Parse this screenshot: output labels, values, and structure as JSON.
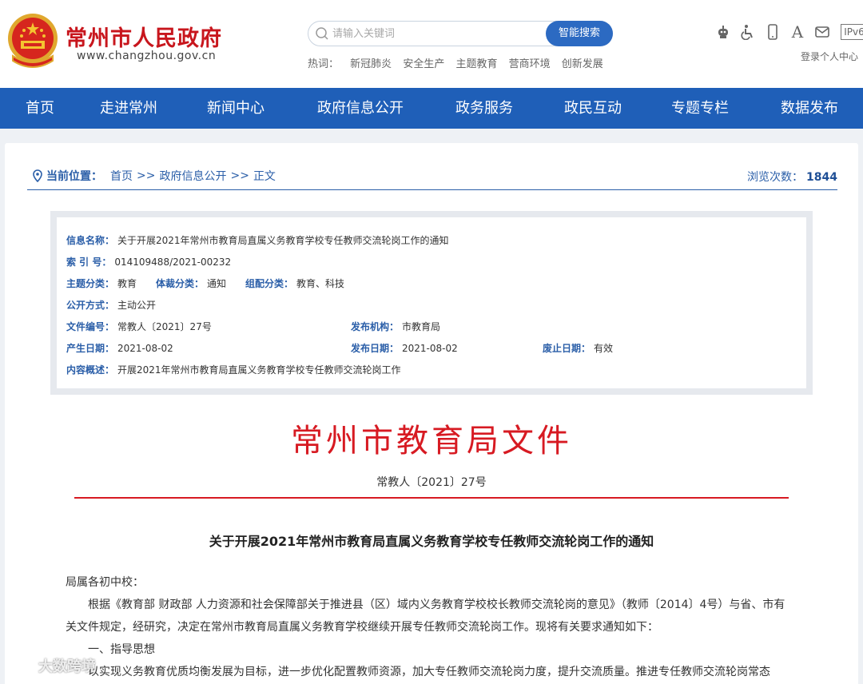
{
  "header": {
    "site_title": "常州市人民政府",
    "site_url": "www.changzhou.gov.cn",
    "emblem_icon": "national-emblem-icon",
    "search": {
      "placeholder": "请输入关键词",
      "button_label": "智能搜索",
      "hot_label": "热词：",
      "hot_words": [
        "新冠肺炎",
        "安全生产",
        "主题教育",
        "营商环境",
        "创新发展"
      ]
    },
    "tools": {
      "icons": [
        "robot-icon",
        "accessibility-icon",
        "mobile-icon",
        "font-size-icon",
        "mail-icon"
      ],
      "font_glyph": "A",
      "ipv6_label": "IPv6",
      "login_label": "登录个人中心"
    }
  },
  "nav": {
    "items": [
      "首页",
      "走进常州",
      "新闻中心",
      "政府信息公开",
      "政务服务",
      "政民互动",
      "专题专栏",
      "数据发布"
    ]
  },
  "breadcrumb": {
    "label": "当前位置：",
    "items": [
      "首页",
      "政府信息公开",
      "正文"
    ],
    "separator": ">>",
    "views_label": "浏览次数：",
    "views_count": "1844"
  },
  "meta": {
    "info_name": {
      "k": "信息名称：",
      "v": "关于开展2021年常州市教育局直属义务教育学校专任教师交流轮岗工作的通知"
    },
    "index_no": {
      "k": "索 引 号：",
      "v": "014109488/2021-00232"
    },
    "topic": {
      "k": "主题分类：",
      "v": "教育"
    },
    "genre": {
      "k": "体裁分类：",
      "v": "通知"
    },
    "org_cat": {
      "k": "组配分类：",
      "v": "教育、科技"
    },
    "open_mode": {
      "k": "公开方式：",
      "v": "主动公开"
    },
    "doc_no": {
      "k": "文件编号：",
      "v": "常教人〔2021〕27号"
    },
    "publisher": {
      "k": "发布机构：",
      "v": "市教育局"
    },
    "created": {
      "k": "产生日期：",
      "v": "2021-08-02"
    },
    "published": {
      "k": "发布日期：",
      "v": "2021-08-02"
    },
    "expiry": {
      "k": "废止日期：",
      "v": "有效"
    },
    "summary": {
      "k": "内容概述：",
      "v": "开展2021年常州市教育局直属义务教育学校专任教师交流轮岗工作"
    }
  },
  "document": {
    "heading": "常州市教育局文件",
    "number": "常教人〔2021〕27号",
    "title": "关于开展2021年常州市教育局直属义务教育学校专任教师交流轮岗工作的通知",
    "salutation": "局属各初中校：",
    "para1": "根据《教育部 财政部 人力资源和社会保障部关于推进县（区）域内义务教育学校校长教师交流轮岗的意见》（教师〔2014〕4号）与省、市有关文件规定，经研究，决定在常州市教育局直属义务教育学校继续开展专任教师交流轮岗工作。现将有关要求通知如下：",
    "section1": "一、指导思想",
    "para2": "以实现义务教育优质均衡发展为目标，进一步优化配置教师资源，加大专任教师交流轮岗力度，提升交流质量。推进专任教师交流轮岗常态"
  },
  "watermark": {
    "text": "大数跨境",
    "icon": "watermark-logo-icon"
  },
  "colors": {
    "brand_red": "#c8161d",
    "nav_blue": "#1f5fb8",
    "link_blue": "#2a5ea8",
    "doc_red": "#d71a22"
  }
}
